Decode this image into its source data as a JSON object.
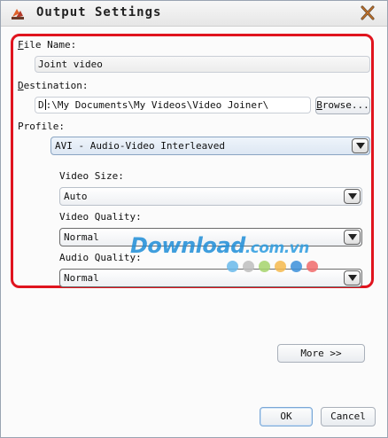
{
  "window": {
    "title": "Output Settings"
  },
  "file_name": {
    "label_u": "F",
    "label_rest": "ile Name:",
    "value": "Joint video"
  },
  "destination": {
    "label_u": "D",
    "label_rest": "estination:",
    "value_head": "D",
    "value_tail": ":\\My Documents\\My Videos\\Video Joiner\\",
    "browse_u": "B",
    "browse_rest": "rowse..."
  },
  "profile": {
    "label": "Profile:",
    "selected": "AVI - Audio-Video Interleaved"
  },
  "video_size": {
    "label": "Video Size:",
    "selected": "Auto"
  },
  "video_quality": {
    "label": "Video Quality:",
    "selected": "Normal"
  },
  "audio_quality": {
    "label": "Audio Quality:",
    "selected": "Normal"
  },
  "buttons": {
    "more": "More >>",
    "ok": "OK",
    "cancel": "Cancel"
  },
  "watermark": {
    "main": "Download",
    "suffix": ".com.vn",
    "dot_colors": [
      "#69b8ea",
      "#bdbdbd",
      "#a5d36b",
      "#f5b94c",
      "#3b8fd9",
      "#f06a6a"
    ]
  },
  "colors": {
    "highlight": "#e0141e",
    "watermark": "#1f8ed8"
  }
}
